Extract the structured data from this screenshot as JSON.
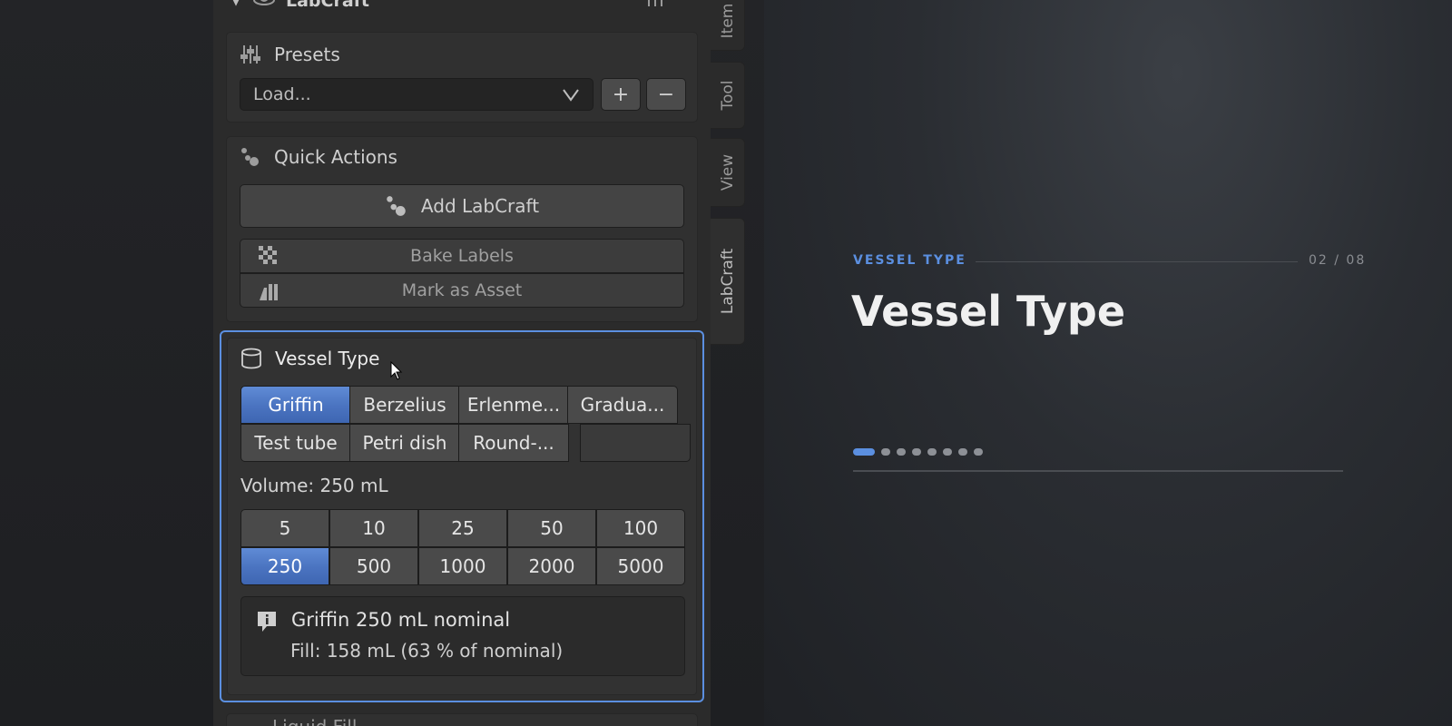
{
  "panel": {
    "title": "LabCraft",
    "presets": {
      "title": "Presets",
      "select_value": "Load..."
    },
    "quick_actions": {
      "title": "Quick Actions",
      "add_button": "Add LabCraft",
      "bake_button": "Bake Labels",
      "mark_button": "Mark as Asset"
    },
    "vessel": {
      "title": "Vessel Type",
      "types": [
        "Griffin",
        "Berzelius",
        "Erlenme...",
        "Gradua...",
        "Test tube",
        "Petri dish",
        "Round-..."
      ],
      "selected_type": "Griffin",
      "volume_label": "Volume: 250 mL",
      "volumes": [
        "5",
        "10",
        "25",
        "50",
        "100",
        "250",
        "500",
        "1000",
        "2000",
        "5000"
      ],
      "selected_volume": "250",
      "info_line1": "Griffin 250 mL nominal",
      "info_line2": "Fill: 158 mL (63 % of nominal)"
    },
    "next_section": "Liquid Fill"
  },
  "tabs": [
    "Item",
    "Tool",
    "View",
    "LabCraft"
  ],
  "active_tab": "LabCraft",
  "slide": {
    "eyebrow": "VESSEL TYPE",
    "counter": "02 / 08",
    "title": "Vessel Type",
    "total_steps": 8,
    "current_step": 1
  },
  "colors": {
    "accent": "#5b8fe0",
    "active_button": "#4a73c0"
  },
  "icons": {
    "presets": "sliders-icon",
    "quick_actions": "dots-icon",
    "bake": "checker-icon",
    "mark": "asset-icon",
    "vessel": "cylinder-icon",
    "info": "info-icon"
  }
}
